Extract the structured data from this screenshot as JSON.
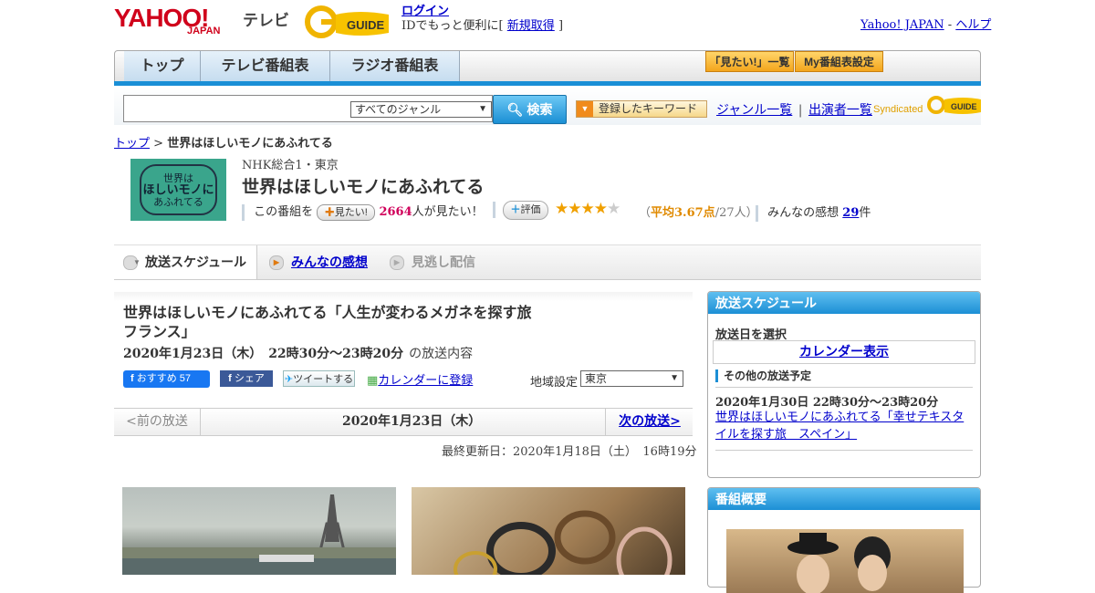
{
  "header": {
    "logo_yahoo": "YAHOO!",
    "logo_japan": "JAPAN",
    "logo_tv": "テレビ",
    "login": "ログイン",
    "login_sub_pre": "IDでもっと便利に[",
    "register": "新規取得",
    "login_sub_post": "]",
    "yahoo_japan_link": "Yahoo! JAPAN",
    "separator": "-",
    "help_link": "ヘルプ"
  },
  "nav": {
    "tabs": [
      "トップ",
      "テレビ番組表",
      "ラジオ番組表"
    ],
    "mitai_list": "「見たい!」一覧",
    "my_bangumi": "My番組表設定"
  },
  "search": {
    "genre_select": "すべてのジャンル",
    "button": "検索",
    "keyword_button": "登録したキーワード",
    "genre_list": "ジャンル一覧",
    "divider": "|",
    "cast_list": "出演者一覧",
    "syndicated": "Syndicated"
  },
  "breadcrumb": {
    "top": "トップ",
    "sep": ">",
    "current": "世界はほしいモノにあふれてる"
  },
  "program": {
    "channel": "NHK総合1・東京",
    "title": "世界はほしいモノにあふれてる",
    "thumb_text_1": "世界は",
    "thumb_text_2": "ほしいモノに",
    "thumb_text_3": "あふれてる",
    "watch_pre": "この番組を",
    "mitai_btn": "見たい!",
    "mitai_count": "2664",
    "mitai_post": "人が見たい！",
    "hyouka_btn": "評価",
    "stars": "★★★★☆",
    "avg_pre": "（",
    "avg_label": "平均3.67点",
    "avg_post": "/27人）",
    "kansou_label": "みんなの感想",
    "kansou_count": "29",
    "kansou_unit": "件"
  },
  "tabs": {
    "schedule": "放送スケジュール",
    "impressions": "みんなの感想",
    "streaming": "見逃し配信"
  },
  "episode": {
    "title": "世界はほしいモノにあふれてる「人生が変わるメガネを探す旅　フランス」",
    "date": "2020年1月23日（木）　22時30分～23時20分",
    "date_sub": "の放送内容",
    "fb_label": "おすすめ 57",
    "share_label": "シェア",
    "tweet_label": "ツイートする",
    "calendar_link": "カレンダーに登録",
    "region_label": "地域設定",
    "region_value": "東京"
  },
  "pager": {
    "prev": "<前の放送",
    "date": "2020年1月23日（木）",
    "next": "次の放送>"
  },
  "updated": "最終更新日：2020年1月18日（土）　16時19分",
  "sidebar": {
    "schedule_head": "放送スケジュール",
    "select_date": "放送日を選択",
    "calendar_display": "カレンダー表示",
    "other_label": "その他の放送予定",
    "other_date": "2020年1月30日  22時30分～23時20分",
    "other_link": "世界はほしいモノにあふれてる「幸せテキスタイルを探す旅　スペイン」",
    "gaiyou_head": "番組概要"
  },
  "colors": {
    "accent_blue": "#1a8fd6",
    "yahoo_red": "#d0021b",
    "link": "#0000cc"
  }
}
